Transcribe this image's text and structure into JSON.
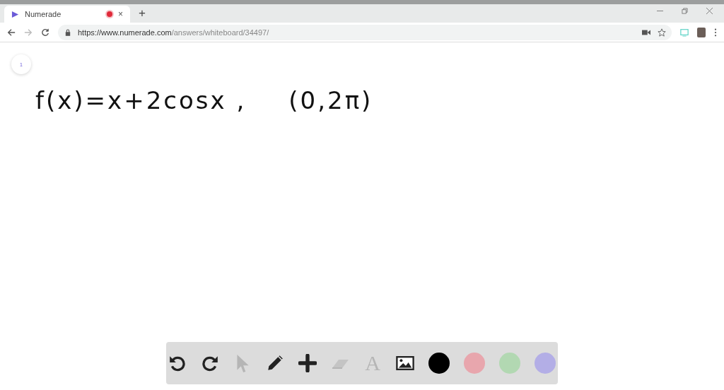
{
  "tab": {
    "title": "Numerade",
    "recording": true,
    "close": "×",
    "new_tab": "+"
  },
  "address_bar": {
    "host": "https://www.numerade.com",
    "path": "/answers/whiteboard/34497/"
  },
  "page_badge": "1",
  "whiteboard_text": [
    "f(x)=x+2cosx ,",
    "(0,2π)"
  ],
  "tools": [
    {
      "kind": "undo",
      "disabled": false
    },
    {
      "kind": "redo",
      "disabled": false
    },
    {
      "kind": "select",
      "disabled": true
    },
    {
      "kind": "pen",
      "disabled": false
    },
    {
      "kind": "plus",
      "disabled": false
    },
    {
      "kind": "eraser",
      "disabled": true
    },
    {
      "kind": "text",
      "disabled": true,
      "glyph": "A"
    },
    {
      "kind": "image",
      "disabled": false
    }
  ],
  "colors": [
    {
      "color": "#000000"
    },
    {
      "color": "#e8a6ad"
    },
    {
      "color": "#b2d8b2"
    },
    {
      "color": "#b3aee6"
    }
  ]
}
